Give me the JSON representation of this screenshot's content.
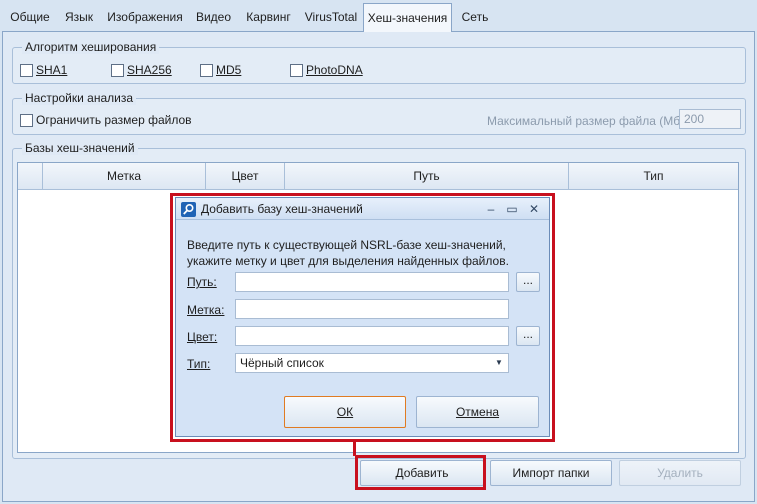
{
  "tabs": [
    {
      "label": "Общие"
    },
    {
      "label": "Язык"
    },
    {
      "label": "Изображения"
    },
    {
      "label": "Видео"
    },
    {
      "label": "Карвинг"
    },
    {
      "label": "VirusTotal"
    },
    {
      "label": "Хеш-значения"
    },
    {
      "label": "Сеть"
    }
  ],
  "hash_algorithms": {
    "legend": "Алгоритм хеширования",
    "options": [
      {
        "label": "SHA1",
        "checked": false
      },
      {
        "label": "SHA256",
        "checked": false
      },
      {
        "label": "MD5",
        "checked": false
      },
      {
        "label": "PhotoDNA",
        "checked": false
      }
    ]
  },
  "analysis": {
    "legend": "Настройки анализа",
    "limit_label": "Ограничить размер файлов",
    "limit_checked": false,
    "max_size_label": "Максимальный размер файла (Мб):",
    "max_size_value": "200"
  },
  "hash_db": {
    "legend": "Базы хеш-значений",
    "columns": [
      "Метка",
      "Цвет",
      "Путь",
      "Тип"
    ],
    "rows": []
  },
  "buttons": {
    "add": "Добавить",
    "import": "Импорт папки",
    "delete": "Удалить"
  },
  "dialog": {
    "title": "Добавить базу хеш-значений",
    "description": "Введите путь к существующей NSRL-базе хеш-значений, укажите метку и цвет для выделения найденных файлов.",
    "path_label": "Путь:",
    "path_value": "",
    "tag_label": "Метка:",
    "tag_value": "",
    "color_label": "Цвет:",
    "color_value": "",
    "type_label": "Тип:",
    "type_value": "Чёрный список",
    "browse_label": "...",
    "ok": "ОК",
    "cancel": "Отмена",
    "minimize": "–",
    "maximize": "▭",
    "close": "✕"
  },
  "colors": {
    "highlight": "#c8101e",
    "accent": "#1f63b5",
    "default_button_border": "#e07b22"
  }
}
